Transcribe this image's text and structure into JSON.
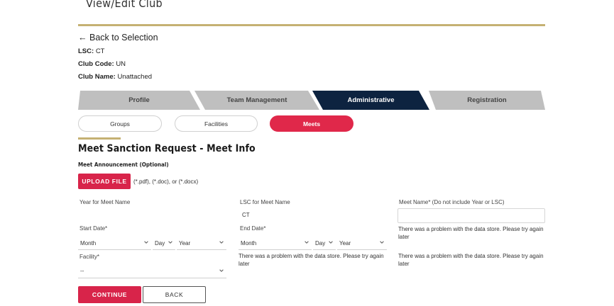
{
  "header": {
    "title": "View/Edit Club"
  },
  "nav": {
    "back_label": "Back to Selection"
  },
  "club": {
    "lsc_label": "LSC:",
    "lsc_value": "CT",
    "code_label": "Club Code:",
    "code_value": "UN",
    "name_label": "Club Name:",
    "name_value": "Unattached"
  },
  "tabs": [
    {
      "label": "Profile"
    },
    {
      "label": "Team Management"
    },
    {
      "label": "Administrative"
    },
    {
      "label": "Registration"
    }
  ],
  "subtabs": [
    {
      "label": "Groups"
    },
    {
      "label": "Facilities"
    },
    {
      "label": "Meets"
    }
  ],
  "form": {
    "title": "Meet Sanction Request - Meet Info",
    "announcement_label": "Meet Announcement (Optional)",
    "upload_button": "UPLOAD FILE",
    "upload_note": "(*.pdf), (*.doc), or (*.docx)",
    "year_label": "Year for Meet Name",
    "lsc_label": "LSC for Meet Name",
    "lsc_value": "CT",
    "meet_name_label": "Meet Name* (Do not include Year or LSC)",
    "meet_name_value": "",
    "meet_name_error": "There was a problem with the data store. Please try again later",
    "start_date_label": "Start Date*",
    "end_date_label": "End Date*",
    "start_month": "Month",
    "start_day": "Day",
    "start_year": "Year",
    "end_month": "Month",
    "end_day": "Day",
    "end_year": "Year",
    "end_date_error": "There was a problem with the data store. Please try again later",
    "third_error": "There was a problem with the data store. Please try again later",
    "facility_label": "Facility*",
    "facility_value": "--",
    "continue_button": "CONTINUE",
    "back_button": "BACK"
  },
  "colors": {
    "accent_red": "#d8244a",
    "navy": "#0d2340",
    "gold": "#c5b173",
    "tab_gray": "#bfbfbf"
  }
}
